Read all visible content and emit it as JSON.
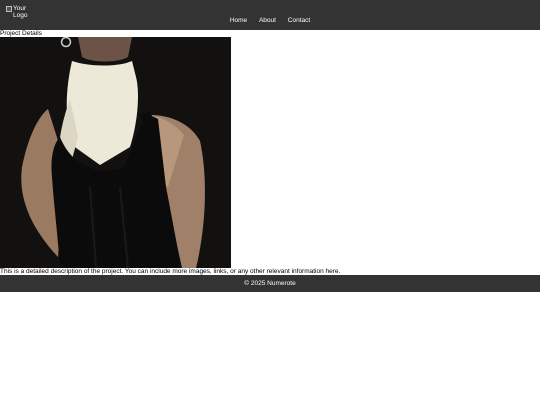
{
  "header": {
    "logo_alt": "Your Logo",
    "nav": [
      {
        "label": "Home"
      },
      {
        "label": "About"
      },
      {
        "label": "Contact"
      }
    ]
  },
  "main": {
    "title": "Project Details",
    "image_icon": "photo-image",
    "description": "This is a detailed description of the project. You can include more images, links, or any other relevant information here."
  },
  "footer": {
    "copyright": "© 2025 Numerote"
  },
  "colors": {
    "header_bg": "#333333",
    "footer_bg": "#333333",
    "text_light": "#ffffff"
  }
}
